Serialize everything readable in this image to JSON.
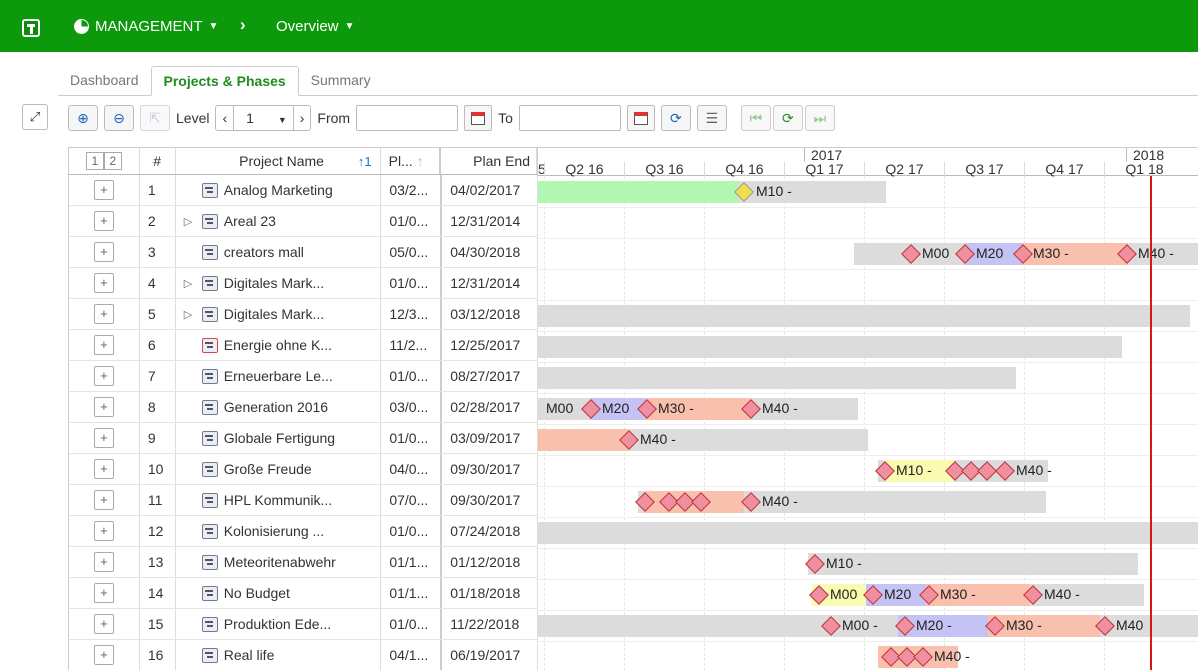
{
  "topbar": {
    "module": "MANAGEMENT",
    "view": "Overview"
  },
  "tabs": [
    "Dashboard",
    "Projects & Phases",
    "Summary"
  ],
  "toolbar": {
    "level_label": "Level",
    "level_value": "1",
    "from_label": "From",
    "to_label": "To",
    "from_value": "",
    "to_value": ""
  },
  "grid": {
    "level_buttons": [
      "1",
      "2"
    ],
    "headers": {
      "num": "#",
      "name": "Project Name",
      "plan_start": "Pl...",
      "plan_end": "Plan End"
    },
    "rows": [
      {
        "num": "1",
        "name": "Analog Marketing",
        "start": "03/2...",
        "end": "04/02/2017",
        "expandable": false
      },
      {
        "num": "2",
        "name": "Areal 23",
        "start": "01/0...",
        "end": "12/31/2014",
        "expandable": true
      },
      {
        "num": "3",
        "name": "creators mall",
        "start": "05/0...",
        "end": "04/30/2018",
        "expandable": false
      },
      {
        "num": "4",
        "name": "Digitales Mark...",
        "start": "01/0...",
        "end": "12/31/2014",
        "expandable": true
      },
      {
        "num": "5",
        "name": "Digitales Mark...",
        "start": "12/3...",
        "end": "03/12/2018",
        "expandable": true
      },
      {
        "num": "6",
        "name": "Energie ohne K...",
        "start": "11/2...",
        "end": "12/25/2017",
        "expandable": false
      },
      {
        "num": "7",
        "name": "Erneuerbare Le...",
        "start": "01/0...",
        "end": "08/27/2017",
        "expandable": false
      },
      {
        "num": "8",
        "name": "Generation 2016",
        "start": "03/0...",
        "end": "02/28/2017",
        "expandable": false
      },
      {
        "num": "9",
        "name": "Globale Fertigung",
        "start": "01/0...",
        "end": "03/09/2017",
        "expandable": false
      },
      {
        "num": "10",
        "name": "Große Freude",
        "start": "04/0...",
        "end": "09/30/2017",
        "expandable": false
      },
      {
        "num": "11",
        "name": "HPL Kommunik...",
        "start": "07/0...",
        "end": "09/30/2017",
        "expandable": false
      },
      {
        "num": "12",
        "name": "Kolonisierung ...",
        "start": "01/0...",
        "end": "07/24/2018",
        "expandable": false
      },
      {
        "num": "13",
        "name": "Meteoritenabwehr",
        "start": "01/1...",
        "end": "01/12/2018",
        "expandable": false
      },
      {
        "num": "14",
        "name": "No Budget",
        "start": "01/1...",
        "end": "01/18/2018",
        "expandable": false
      },
      {
        "num": "15",
        "name": "Produktion Ede...",
        "start": "01/0...",
        "end": "11/22/2018",
        "expandable": false
      },
      {
        "num": "16",
        "name": "Real life",
        "start": "04/1...",
        "end": "06/19/2017",
        "expandable": false
      }
    ]
  },
  "gantt": {
    "years": [
      "2017",
      "2018"
    ],
    "quarters": [
      "Q2 16",
      "Q3 16",
      "Q4 16",
      "Q1 17",
      "Q2 17",
      "Q3 17",
      "Q4 17",
      "Q1 18"
    ],
    "edge_quarter_fragment": "5",
    "colors": {
      "bar_gray": "#dcdcdc",
      "phase_green": "#b3f5b3",
      "phase_blue": "#c5c3f4",
      "phase_salmon": "#f9c0ae",
      "phase_yellow": "#fafab0",
      "milestone_pink": "#f08fa0",
      "milestone_yellow": "#f0e050",
      "today_line": "#d41818",
      "topbar": "#0c9a0c"
    },
    "milestones": {
      "r1": [
        "M10 -"
      ],
      "r3": [
        "M00",
        "M20",
        "M30 -",
        "M40 -"
      ],
      "r8": [
        "M00",
        "M20",
        "M30 -",
        "M40 -"
      ],
      "r9": [
        "M40 -"
      ],
      "r10": [
        "M10 -",
        "M40 -"
      ],
      "r11": [
        "M40 -"
      ],
      "r13": [
        "M10 -"
      ],
      "r14": [
        "M00",
        "M20",
        "M30 -",
        "M40 -"
      ],
      "r15": [
        "M00 -",
        "M20 -",
        "M30 -",
        "M40"
      ],
      "r16": [
        "M40 -"
      ]
    }
  }
}
